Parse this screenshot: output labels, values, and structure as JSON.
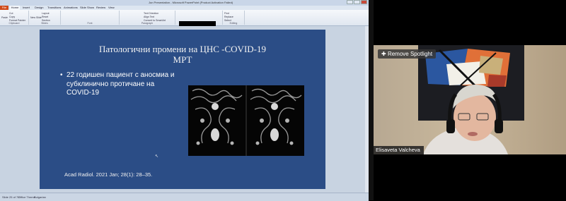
{
  "powerpoint": {
    "window_title": "Jun Presentation - Microsoft PowerPoint (Product Activation Failed)",
    "tabs": [
      "File",
      "Home",
      "Insert",
      "Design",
      "Transitions",
      "Animations",
      "Slide Show",
      "Review",
      "View"
    ],
    "ribbon_groups": [
      "Clipboard",
      "Slides",
      "Font",
      "Paragraph",
      "Drawing",
      "Editing"
    ],
    "ribbon_items": {
      "paste": "Paste",
      "cut": "Cut",
      "copy": "Copy",
      "format_painter": "Format Painter",
      "new_slide": "New Slide",
      "layout": "Layout",
      "reset": "Reset",
      "section": "Section",
      "text_direction": "Text Direction",
      "align_text": "Align Text",
      "convert_smartart": "Convert to SmartArt",
      "find": "Find",
      "replace": "Replace",
      "select": "Select"
    },
    "slide": {
      "title_line1": "Патологични промени на ЦНС -COVID-19",
      "title_line2": "МРТ",
      "bullet_symbol": "•",
      "bullet_text": "22 годишен пациент с аносмиа и субклинично протичане на COVID-19",
      "citation": "Acad Radiol. 2021 Jan; 28(1): 28–35."
    },
    "status": {
      "slide_counter": "Slide 25 of 70",
      "theme": "Office Theme",
      "language": "Bulgarian"
    }
  },
  "zoom_panel": {
    "remove_spotlight_label": "Remove Spotlight",
    "participant_name": "Elisaveta Valcheva"
  },
  "colors": {
    "slide_bg": "#2b4d86",
    "file_tab": "#d04a1a",
    "ribbon_bg": "#f6f8fb"
  }
}
